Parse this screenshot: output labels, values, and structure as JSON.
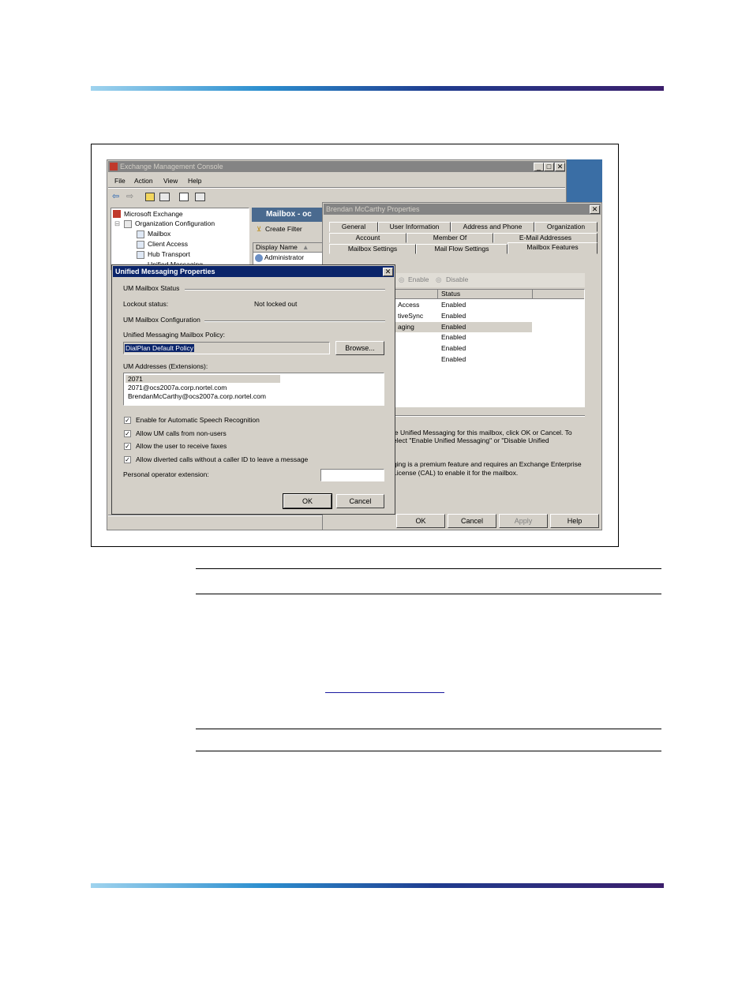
{
  "emc": {
    "title": "Exchange Management Console",
    "min_glyph": "_",
    "max_glyph": "□",
    "close_glyph": "✕",
    "menu": [
      "File",
      "Action",
      "View",
      "Help"
    ],
    "tree": [
      "Microsoft Exchange",
      "Organization Configuration",
      "Mailbox",
      "Client Access",
      "Hub Transport",
      "Unified Messaging"
    ],
    "panel_title": "Mailbox - oc",
    "create_filter": "Create Filter",
    "list_header": "Display Name",
    "list_rows": [
      "Administrator"
    ]
  },
  "props": {
    "title": "Brendan McCarthy Properties",
    "close_glyph": "✕",
    "tabs_row1": [
      "General",
      "User Information",
      "Address and Phone",
      "Organization"
    ],
    "tabs_row2": [
      "Account",
      "Member Of",
      "E-Mail Addresses"
    ],
    "tabs_row3": [
      "Mailbox Settings",
      "Mail Flow Settings",
      "Mailbox Features"
    ],
    "enable_label": "Enable",
    "disable_label": "Disable",
    "status_header": "Status",
    "features": [
      {
        "name": "Access",
        "status": "Enabled"
      },
      {
        "name": "tiveSync",
        "status": "Enabled"
      },
      {
        "name": "aging",
        "status": "Enabled"
      },
      {
        "name": "",
        "status": "Enabled"
      },
      {
        "name": "",
        "status": "Enabled"
      },
      {
        "name": "",
        "status": "Enabled"
      }
    ],
    "desc1_line1": "le Unified Messaging for this mailbox, click OK or Cancel. To",
    "desc1_line2": "elect \"Enable Unified Messaging\" or \"Disable Unified",
    "desc2_line1": "ging is a premium feature and requires an Exchange Enterprise",
    "desc2_line2": "License (CAL) to enable it for the mailbox.",
    "buttons": {
      "ok": "OK",
      "cancel": "Cancel",
      "apply": "Apply",
      "help": "Help"
    }
  },
  "um": {
    "title": "Unified Messaging Properties",
    "close_glyph": "✕",
    "status_group": "UM Mailbox Status",
    "lockout_label": "Lockout status:",
    "lockout_value": "Not locked out",
    "config_group": "UM Mailbox Configuration",
    "policy_label": "Unified Messaging Mailbox Policy:",
    "policy_value": "DialPlan Default Policy",
    "browse_label": "Browse...",
    "addresses_label": "UM Addresses (Extensions):",
    "addresses": [
      "2071",
      "2071@ocs2007a.corp.nortel.com",
      "BrendanMcCarthy@ocs2007a.corp.nortel.com"
    ],
    "checkboxes": [
      {
        "label": "Enable for Automatic Speech Recognition",
        "checked": true
      },
      {
        "label": "Allow UM calls from non-users",
        "checked": true
      },
      {
        "label": "Allow the user to receive faxes",
        "checked": true
      },
      {
        "label": "Allow diverted calls without a caller ID to leave a message",
        "checked": true
      }
    ],
    "operator_label": "Personal operator extension:",
    "operator_value": "",
    "check_glyph": "✓",
    "ok_label": "OK",
    "cancel_label": "Cancel"
  },
  "colors": {
    "active_title": "#0a246a",
    "inactive_title": "#848484",
    "dialog_face": "#d4d0c8"
  }
}
